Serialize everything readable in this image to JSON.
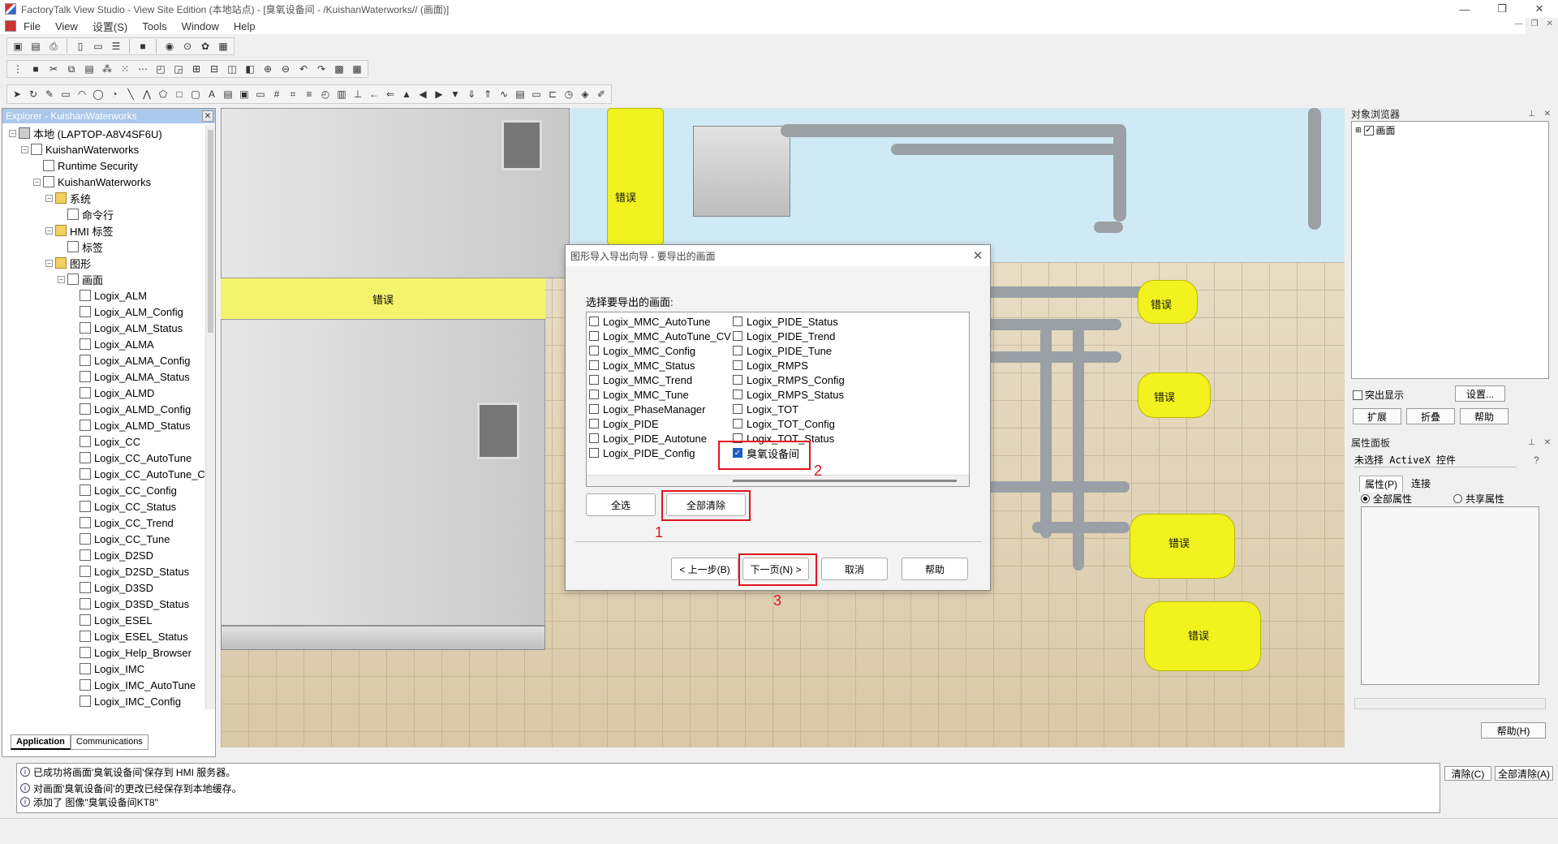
{
  "window": {
    "title": "FactoryTalk View Studio - View Site Edition  (本地站点)  - [臭氧设备间 - /KuishanWaterworks// (画面)]",
    "controls": [
      "—",
      "❐",
      "✕"
    ]
  },
  "menu": [
    "File",
    "View",
    "设置(S)",
    "Tools",
    "Window",
    "Help"
  ],
  "explorer": {
    "title": "Explorer - KuishanWaterworks",
    "tree": [
      {
        "label": "本地 (LAPTOP-A8V4SF6U)",
        "icon": "computer-icon",
        "level": 0,
        "pm": "−"
      },
      {
        "label": "KuishanWaterworks",
        "icon": "application-icon",
        "level": 1,
        "pm": "−"
      },
      {
        "label": "Runtime Security",
        "icon": "key-icon",
        "level": 2,
        "pm": ""
      },
      {
        "label": "KuishanWaterworks",
        "icon": "hmi-server-icon",
        "level": 2,
        "pm": "−"
      },
      {
        "label": "系统",
        "icon": "folder-icon",
        "level": 3,
        "pm": "−"
      },
      {
        "label": "命令行",
        "icon": "command-icon",
        "level": 4,
        "pm": ""
      },
      {
        "label": "HMI 标签",
        "icon": "folder-icon",
        "level": 3,
        "pm": "−"
      },
      {
        "label": "标签",
        "icon": "tag-icon",
        "level": 4,
        "pm": ""
      },
      {
        "label": "图形",
        "icon": "folder-icon",
        "level": 3,
        "pm": "−"
      },
      {
        "label": "画面",
        "icon": "displays-icon",
        "level": 4,
        "pm": "−"
      },
      {
        "label": "Logix_ALM",
        "icon": "document-icon",
        "level": 5,
        "pm": ""
      },
      {
        "label": "Logix_ALM_Config",
        "icon": "document-icon",
        "level": 5,
        "pm": ""
      },
      {
        "label": "Logix_ALM_Status",
        "icon": "document-icon",
        "level": 5,
        "pm": ""
      },
      {
        "label": "Logix_ALMA",
        "icon": "document-icon",
        "level": 5,
        "pm": ""
      },
      {
        "label": "Logix_ALMA_Config",
        "icon": "document-icon",
        "level": 5,
        "pm": ""
      },
      {
        "label": "Logix_ALMA_Status",
        "icon": "document-icon",
        "level": 5,
        "pm": ""
      },
      {
        "label": "Logix_ALMD",
        "icon": "document-icon",
        "level": 5,
        "pm": ""
      },
      {
        "label": "Logix_ALMD_Config",
        "icon": "document-icon",
        "level": 5,
        "pm": ""
      },
      {
        "label": "Logix_ALMD_Status",
        "icon": "document-icon",
        "level": 5,
        "pm": ""
      },
      {
        "label": "Logix_CC",
        "icon": "document-icon",
        "level": 5,
        "pm": ""
      },
      {
        "label": "Logix_CC_AutoTune",
        "icon": "document-icon",
        "level": 5,
        "pm": ""
      },
      {
        "label": "Logix_CC_AutoTune_C",
        "icon": "document-icon",
        "level": 5,
        "pm": ""
      },
      {
        "label": "Logix_CC_Config",
        "icon": "document-icon",
        "level": 5,
        "pm": ""
      },
      {
        "label": "Logix_CC_Status",
        "icon": "document-icon",
        "level": 5,
        "pm": ""
      },
      {
        "label": "Logix_CC_Trend",
        "icon": "document-icon",
        "level": 5,
        "pm": ""
      },
      {
        "label": "Logix_CC_Tune",
        "icon": "document-icon",
        "level": 5,
        "pm": ""
      },
      {
        "label": "Logix_D2SD",
        "icon": "document-icon",
        "level": 5,
        "pm": ""
      },
      {
        "label": "Logix_D2SD_Status",
        "icon": "document-icon",
        "level": 5,
        "pm": ""
      },
      {
        "label": "Logix_D3SD",
        "icon": "document-icon",
        "level": 5,
        "pm": ""
      },
      {
        "label": "Logix_D3SD_Status",
        "icon": "document-icon",
        "level": 5,
        "pm": ""
      },
      {
        "label": "Logix_ESEL",
        "icon": "document-icon",
        "level": 5,
        "pm": ""
      },
      {
        "label": "Logix_ESEL_Status",
        "icon": "document-icon",
        "level": 5,
        "pm": ""
      },
      {
        "label": "Logix_Help_Browser",
        "icon": "document-icon",
        "level": 5,
        "pm": ""
      },
      {
        "label": "Logix_IMC",
        "icon": "document-icon",
        "level": 5,
        "pm": ""
      },
      {
        "label": "Logix_IMC_AutoTune",
        "icon": "document-icon",
        "level": 5,
        "pm": ""
      },
      {
        "label": "Logix_IMC_Config",
        "icon": "document-icon",
        "level": 5,
        "pm": ""
      }
    ],
    "tabs": [
      "Application",
      "Communications"
    ]
  },
  "canvas": {
    "error_label": "错误"
  },
  "object_browser": {
    "title": "对象浏览器",
    "root": "画面",
    "highlight_label": "突出显示",
    "settings_button": "设置...",
    "expand_button": "扩展",
    "collapse_button": "折叠",
    "help_button": "帮助"
  },
  "property_panel": {
    "title": "属性面板",
    "selection": "未选择 ActiveX 控件",
    "help_glyph": "?",
    "tabs": [
      "属性(P)",
      "连接"
    ],
    "radio_all": "全部属性",
    "radio_shared": "共享属性",
    "help_button": "帮助(H)"
  },
  "output": {
    "lines": [
      "已成功将画面'臭氧设备间'保存到 HMI 服务器。",
      "对画面'臭氧设备间'的更改已经保存到本地缓存。",
      "添加了 图像\"臭氧设备间KT8\""
    ],
    "clear_button": "清除(C)",
    "clear_all_button": "全部清除(A)"
  },
  "dialog": {
    "title": "图形导入导出向导 - 要导出的画面",
    "prompt": "选择要导出的画面:",
    "col1": [
      {
        "label": "Logix_MMC_AutoTune",
        "checked": false
      },
      {
        "label": "Logix_MMC_AutoTune_CV",
        "checked": false
      },
      {
        "label": "Logix_MMC_Config",
        "checked": false
      },
      {
        "label": "Logix_MMC_Status",
        "checked": false
      },
      {
        "label": "Logix_MMC_Trend",
        "checked": false
      },
      {
        "label": "Logix_MMC_Tune",
        "checked": false
      },
      {
        "label": "Logix_PhaseManager",
        "checked": false
      },
      {
        "label": "Logix_PIDE",
        "checked": false
      },
      {
        "label": "Logix_PIDE_Autotune",
        "checked": false
      },
      {
        "label": "Logix_PIDE_Config",
        "checked": false
      }
    ],
    "col2": [
      {
        "label": "Logix_PIDE_Status",
        "checked": false
      },
      {
        "label": "Logix_PIDE_Trend",
        "checked": false
      },
      {
        "label": "Logix_PIDE_Tune",
        "checked": false
      },
      {
        "label": "Logix_RMPS",
        "checked": false
      },
      {
        "label": "Logix_RMPS_Config",
        "checked": false
      },
      {
        "label": "Logix_RMPS_Status",
        "checked": false
      },
      {
        "label": "Logix_TOT",
        "checked": false
      },
      {
        "label": "Logix_TOT_Config",
        "checked": false
      },
      {
        "label": "Logix_TOT_Status",
        "checked": false
      },
      {
        "label": "臭氧设备间",
        "checked": true
      }
    ],
    "select_all_button": "全选",
    "clear_all_button": "全部清除",
    "back_button": "< 上一步(B)",
    "next_button": "下一页(N) >",
    "cancel_button": "取消",
    "help_button": "帮助",
    "close_glyph": "✕",
    "annotations": [
      "1",
      "2",
      "3"
    ],
    "annotation_color": "#e0141e"
  }
}
